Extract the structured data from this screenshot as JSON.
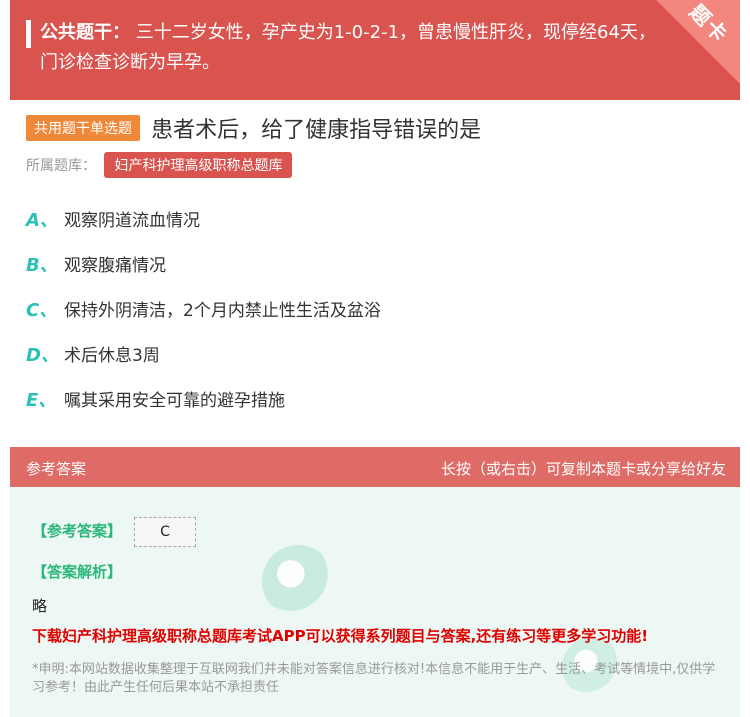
{
  "stem": {
    "label": "公共题干：",
    "text": "三十二岁女性，孕产史为1-0-2-1，曾患慢性肝炎，现停经64天，门诊检查诊断为早孕。",
    "corner_label": "题卡"
  },
  "question": {
    "type_badge": "共用题干单选题",
    "title": "患者术后，给了健康指导错误的是",
    "library_label": "所属题库：",
    "library_name": "妇产科护理高级职称总题库"
  },
  "options": [
    {
      "letter": "A、",
      "text": "观察阴道流血情况"
    },
    {
      "letter": "B、",
      "text": "观察腹痛情况"
    },
    {
      "letter": "C、",
      "text": "保持外阴清洁，2个月内禁止性生活及盆浴"
    },
    {
      "letter": "D、",
      "text": "术后休息3周"
    },
    {
      "letter": "E、",
      "text": "嘱其采用安全可靠的避孕措施"
    }
  ],
  "answer_section": {
    "header_left": "参考答案",
    "header_right": "长按（或右击）可复制本题卡或分享给好友",
    "answer_label": "【参考答案】",
    "answer_value": "C",
    "analysis_label": "【答案解析】",
    "analysis_text": "略",
    "promo": "下载妇产科护理高级职称总题库考试APP可以获得系列题目与答案,还有练习等更多学习功能!",
    "disclaimer": "*申明:本网站数据收集整理于互联网我们并未能对答案信息进行核对!本信息不能用于生产、生活、考试等情境中,仅供学习参考！由此产生任何后果本站不承担责任"
  },
  "colors": {
    "primary_red": "#d9534f",
    "header_red": "#de6b66",
    "badge_orange": "#f0883a",
    "option_letter": "#2dc0b6",
    "answer_green": "#2cb77a",
    "promo_red": "#e00000",
    "answer_bg": "#edf8f4"
  }
}
